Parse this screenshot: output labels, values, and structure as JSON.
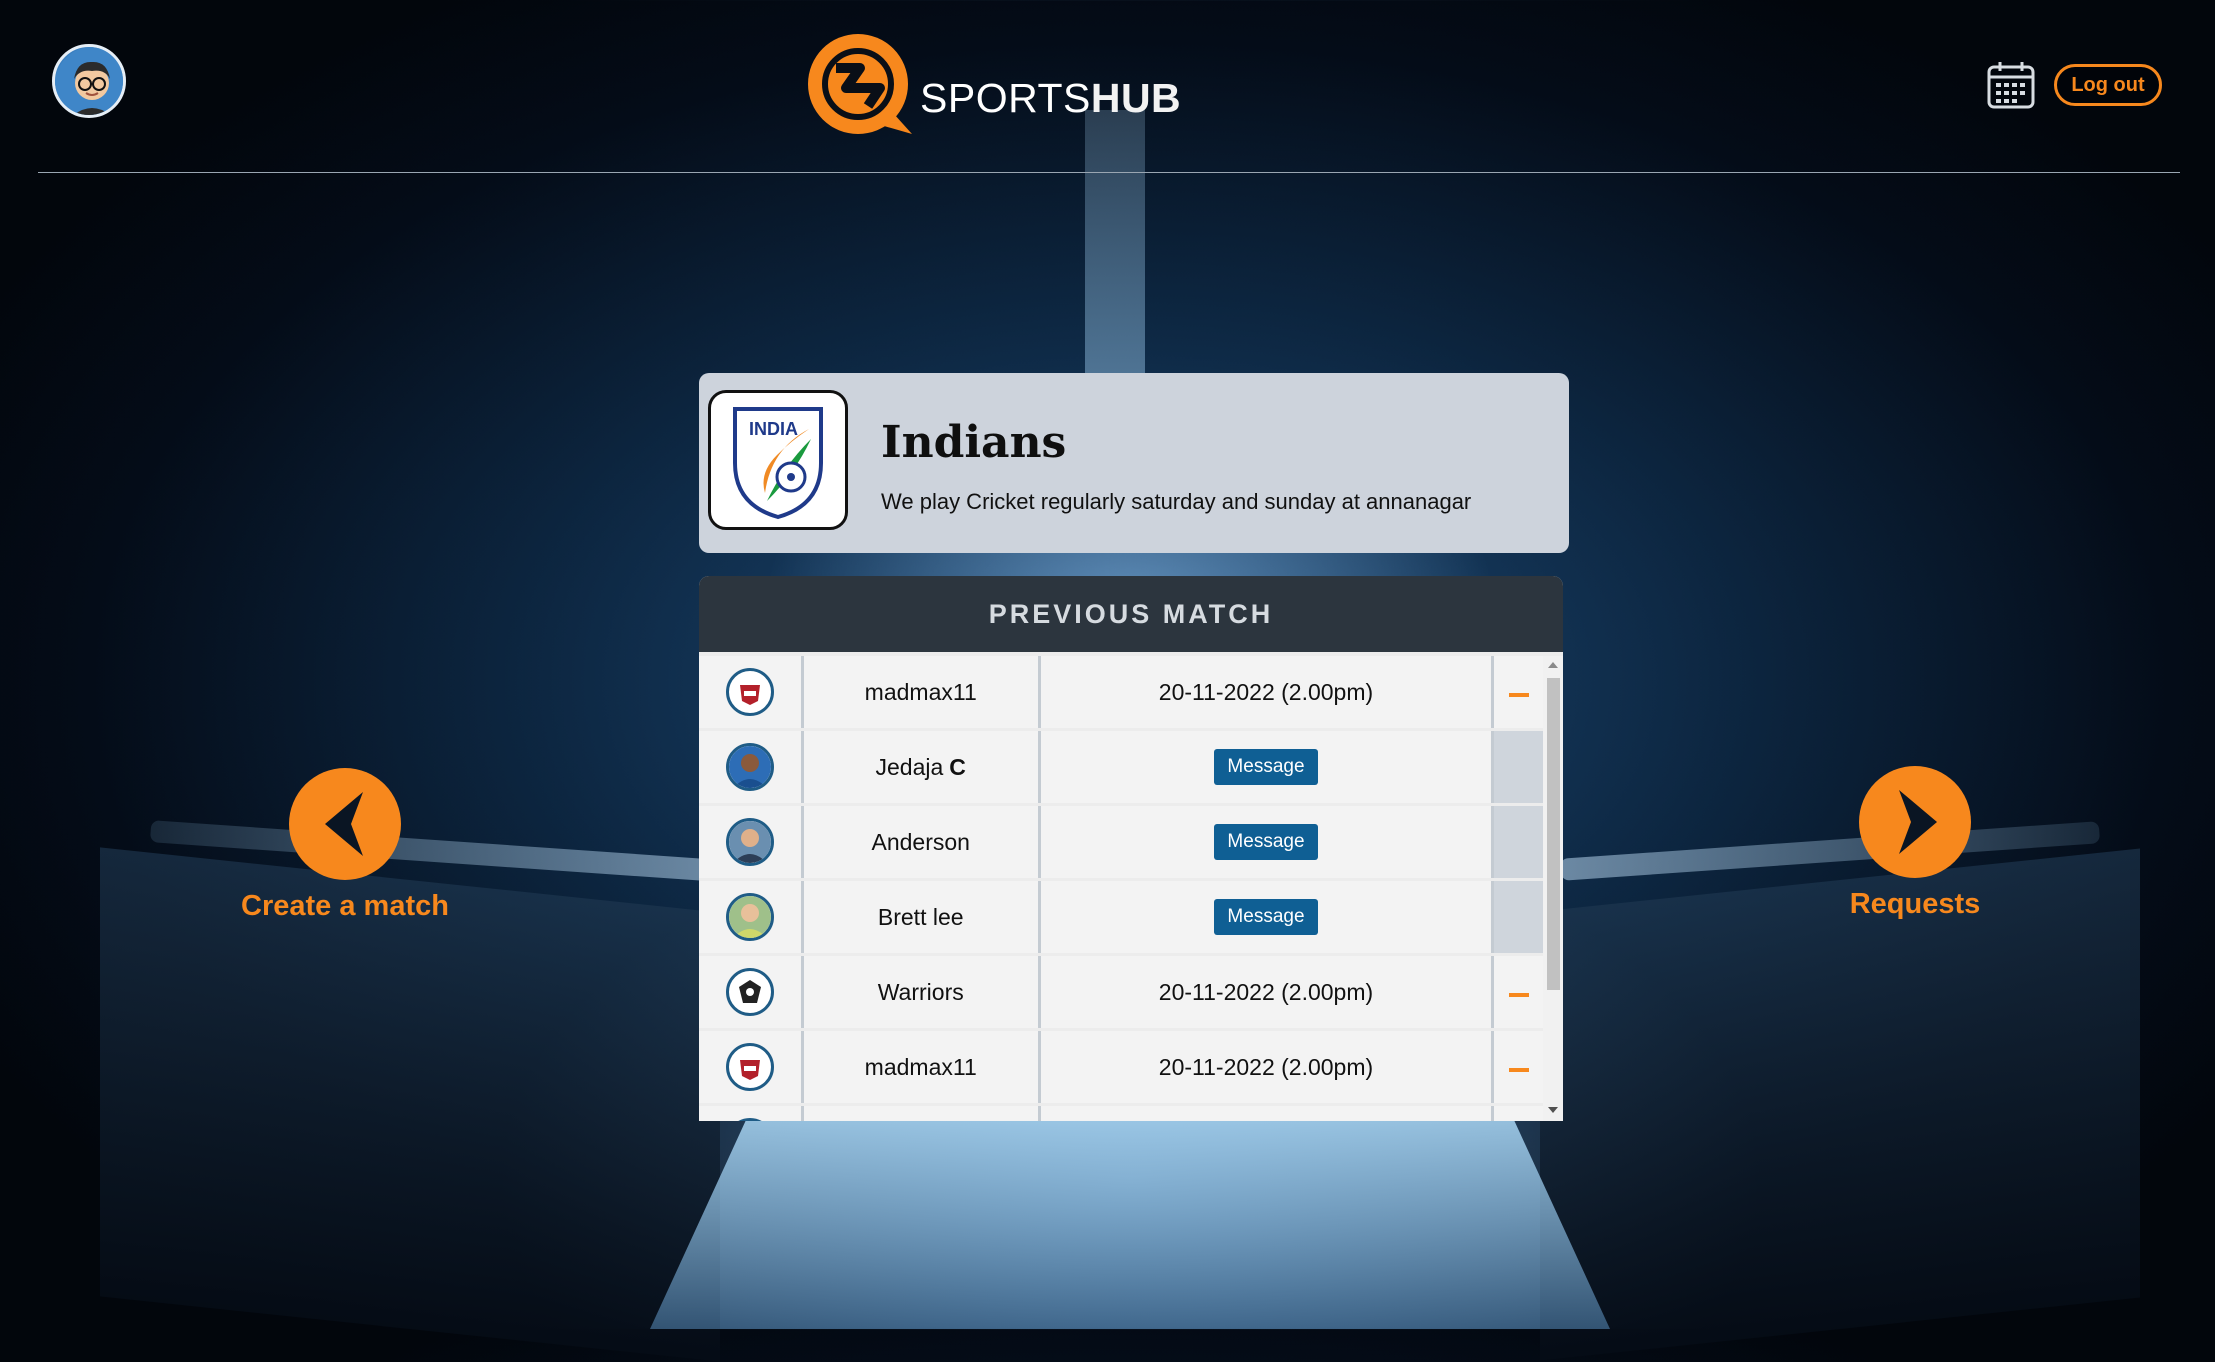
{
  "header": {
    "brand_light": "SPORTS",
    "brand_bold": "HUB",
    "logout_label": "Log out",
    "icons": {
      "avatar": "user-avatar",
      "calendar": "calendar-icon"
    }
  },
  "team": {
    "name": "Indians",
    "description": "We play Cricket regularly saturday and sunday at annanagar",
    "logo_text": "INDIA"
  },
  "previous_match": {
    "title": "PREVIOUS MATCH",
    "rows": [
      {
        "kind": "match",
        "name": "madmax11",
        "date": "20-11-2022 (2.00pm)"
      },
      {
        "kind": "player",
        "name": "Jedaja",
        "badge": "C",
        "action": "Message"
      },
      {
        "kind": "player",
        "name": "Anderson",
        "action": "Message"
      },
      {
        "kind": "player",
        "name": "Brett lee",
        "action": "Message"
      },
      {
        "kind": "match",
        "name": "Warriors",
        "date": "20-11-2022 (2.00pm)"
      },
      {
        "kind": "match",
        "name": "madmax11",
        "date": "20-11-2022 (2.00pm)"
      }
    ]
  },
  "nav": {
    "left_label": "Create a match",
    "right_label": "Requests"
  },
  "colors": {
    "accent": "#f7881d",
    "panel_header": "#2c353e",
    "message_button": "#0f5f94"
  }
}
